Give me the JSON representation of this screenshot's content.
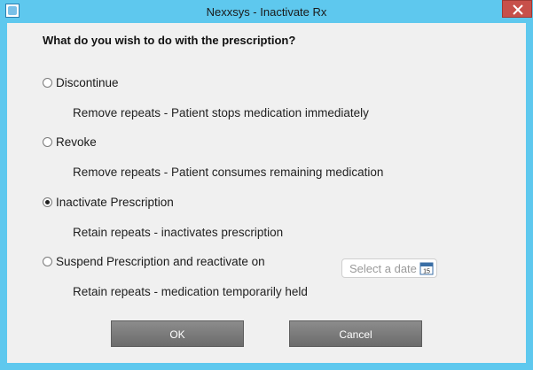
{
  "window": {
    "title": "Nexxsys - Inactivate Rx"
  },
  "dialog": {
    "question": "What do you wish to do with the prescription?",
    "options": [
      {
        "label": "Discontinue",
        "description": "Remove repeats - Patient stops medication immediately",
        "selected": false
      },
      {
        "label": "Revoke",
        "description": "Remove repeats - Patient consumes remaining medication",
        "selected": false
      },
      {
        "label": "Inactivate Prescription",
        "description": "Retain repeats - inactivates prescription",
        "selected": true
      },
      {
        "label": "Suspend Prescription and reactivate on",
        "description": "Retain repeats - medication temporarily held",
        "selected": false
      }
    ],
    "date_picker": {
      "placeholder": "Select a date",
      "icon": "calendar-icon",
      "icon_text": "15"
    },
    "buttons": {
      "ok": "OK",
      "cancel": "Cancel"
    }
  },
  "colors": {
    "titlebar": "#5ec8ee",
    "close_button": "#c7504a",
    "button": "#7a7a7a",
    "background": "#f0f0f0"
  }
}
